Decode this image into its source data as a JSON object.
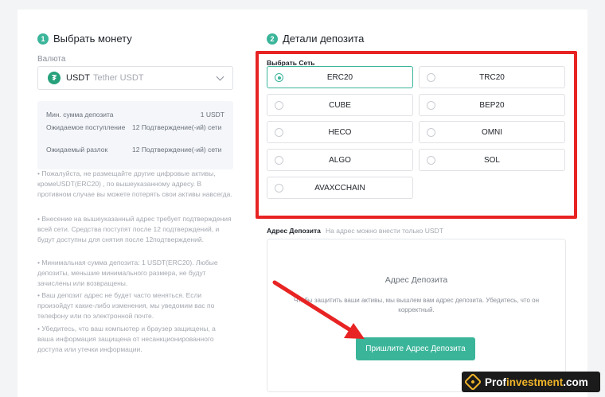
{
  "left": {
    "step_num": "1",
    "step_title": "Выбрать монету",
    "currency_label": "Валюта",
    "coin": {
      "code": "USDT",
      "name": "Tether USDT",
      "icon": "tether-icon"
    },
    "info": {
      "min_key": "Мин. сумма депозита",
      "min_val": "1 USDT",
      "confirm_key": "Ожидаемое поступление",
      "confirm_val": "12 Подтверждение(-ий) сети",
      "unlock_key": "Ожидаемый разлок",
      "unlock_val": "12 Подтверждение(-ий) сети"
    },
    "notes": [
      "• Пожалуйста, не размещайте другие цифровые активы, кромеUSDT(ERC20) , по вышеуказанному адресу. В противном случае вы можете потерять свои активы навсегда.",
      "• Внесение на вышеуказанный адрес требует подтверждения всей сети. Средства поступят после 12 подтверждений, и будут доступны для снятия после 12подтверждений.",
      "• Минимальная сумма депозита: 1 USDT(ERC20). Любые депозиты, меньшие минимального размера, не будут зачислены или возвращены.",
      "• Ваш депозит адрес не будет часто меняться. Если произойдут какие-либо изменения, мы уведомим вас по телефону или по электронной почте.",
      "• Убедитесь, что ваш компьютер и браузер защищены, а ваша информация защищена от несанкционированного доступа или утечки информации."
    ]
  },
  "right": {
    "step_num": "2",
    "step_title": "Детали депозита",
    "network_label": "Выбрать Сеть",
    "networks": [
      "ERC20",
      "TRC20",
      "CUBE",
      "BEP20",
      "HECO",
      "OMNI",
      "ALGO",
      "SOL",
      "AVAXCCHAIN"
    ],
    "selected_network": "ERC20",
    "address_label": "Адрес Депозита",
    "address_hint": "На адрес можно внести только USDT",
    "address_heading": "Адрес Депозита",
    "address_desc": "Чтобы защитить ваши активы, мы вышлем вам адрес депозита. Убедитесь, что он корректный.",
    "generate_button": "Пришлите Адрес Депозита"
  },
  "watermark": {
    "part1": "Prof",
    "part2": "investment",
    "part3": ".com"
  },
  "colors": {
    "accent": "#3bb59a",
    "highlight": "#e82323",
    "tether": "#26a17b"
  }
}
